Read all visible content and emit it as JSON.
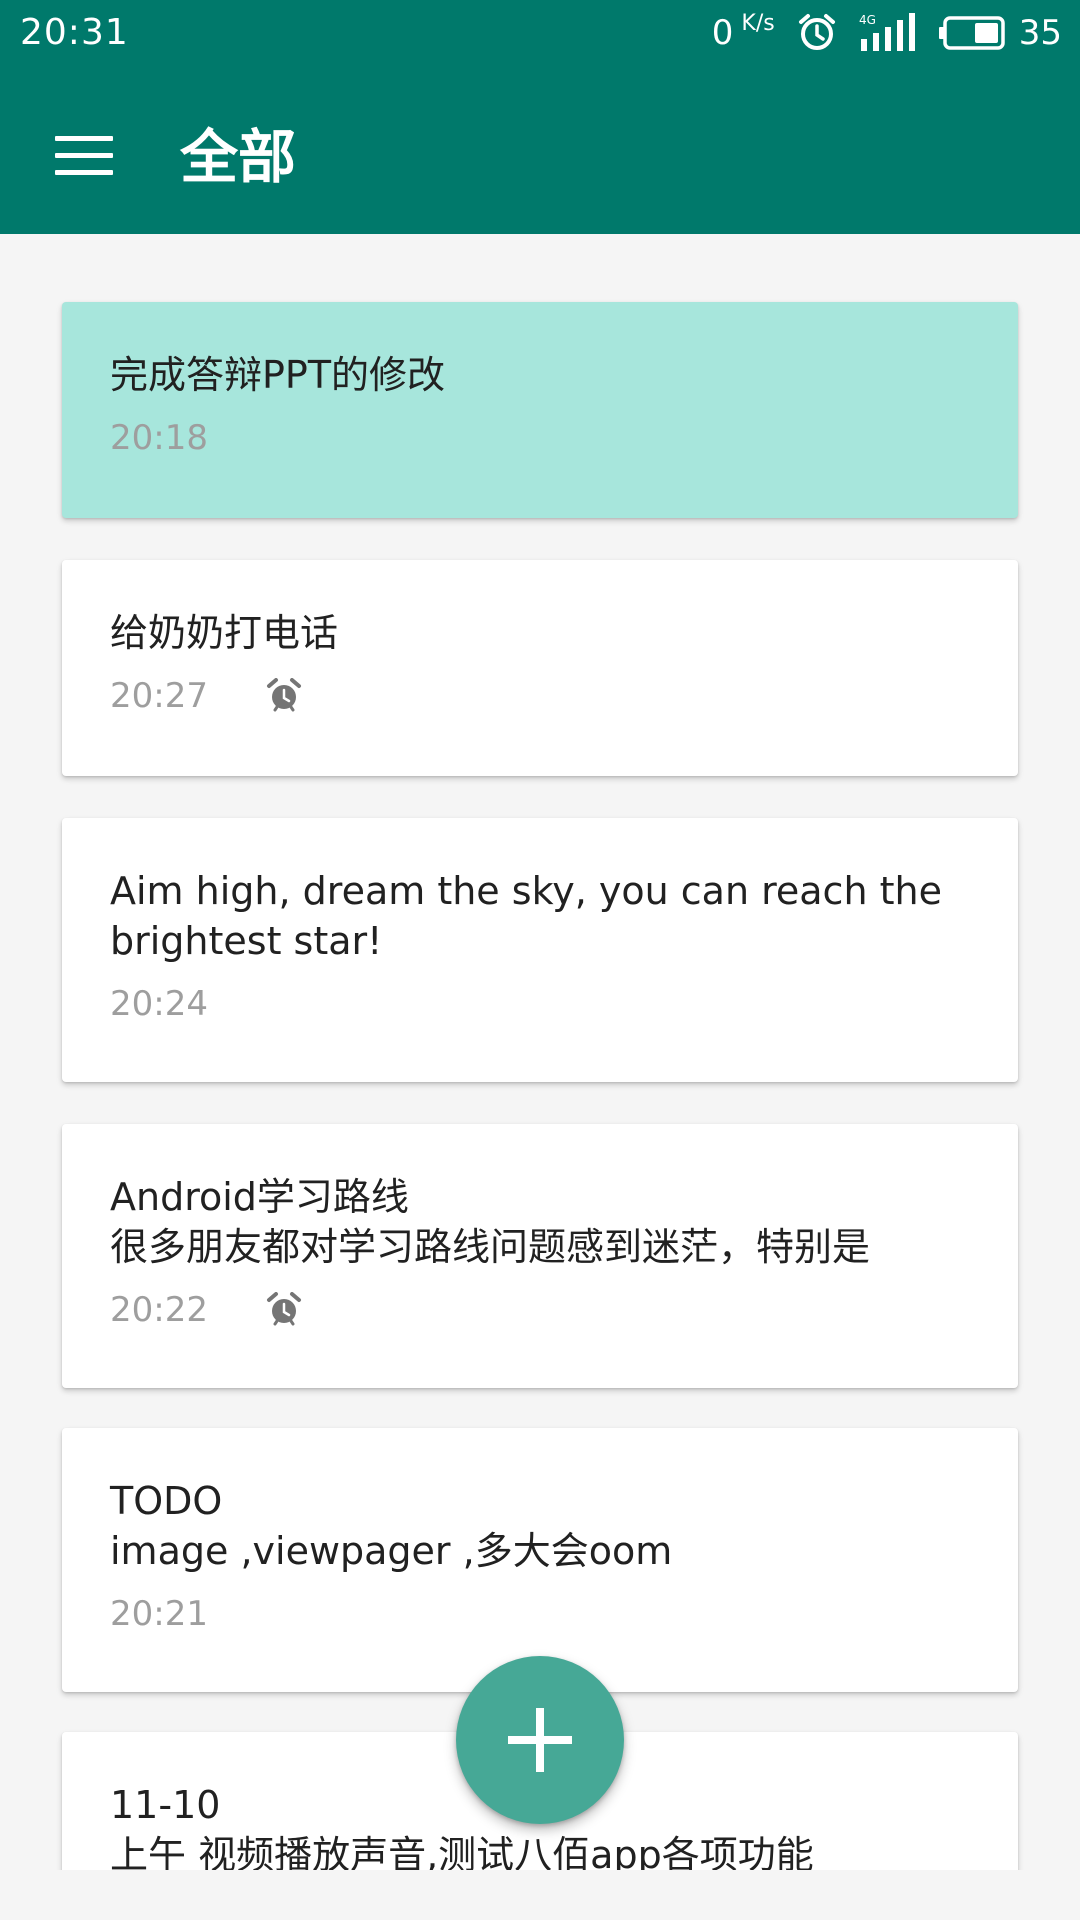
{
  "status_bar": {
    "time": "20:31",
    "net_speed_value": "0",
    "net_speed_unit": "K/s",
    "network_type": "4G",
    "battery": "35"
  },
  "app_bar": {
    "title": "全部"
  },
  "notes": [
    {
      "title": "完成答辩PPT的修改",
      "time": "20:18",
      "has_alarm": false,
      "highlighted": true
    },
    {
      "title": "给奶奶打电话",
      "time": "20:27",
      "has_alarm": true,
      "highlighted": false
    },
    {
      "title": "Aim high, dream the sky, you can reach the\nbrightest star!",
      "time": "20:24",
      "has_alarm": false,
      "highlighted": false
    },
    {
      "title": "Android学习路线\n很多朋友都对学习路线问题感到迷茫，特别是",
      "time": "20:22",
      "has_alarm": true,
      "highlighted": false
    },
    {
      "title": "TODO\nimage ,viewpager ,多大会oom",
      "time": "20:21",
      "has_alarm": false,
      "highlighted": false
    },
    {
      "title": "11-10\n上午 视频播放声音,测试八佰app各项功能",
      "time": "",
      "has_alarm": false,
      "highlighted": false
    }
  ],
  "colors": {
    "primary": "#00796b",
    "highlight_card": "#a7e6dc",
    "fab": "#46a896"
  },
  "icons": {
    "menu": "hamburger-menu-icon",
    "alarm": "alarm-clock-icon",
    "fab": "plus-icon"
  }
}
